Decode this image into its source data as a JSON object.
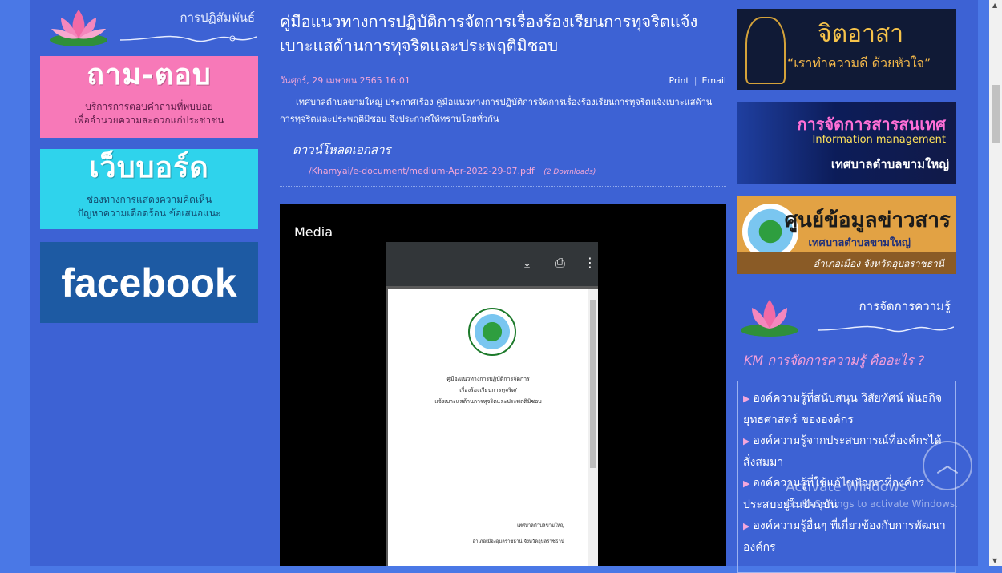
{
  "left": {
    "section_title": "การปฏิสัมพันธ์",
    "qa": {
      "big": "ถาม-ตอบ",
      "line1": "บริการการตอบคำถามที่พบบ่อย",
      "line2": "เพื่ออำนวยความสะดวกแก่ประชาชน"
    },
    "webboard": {
      "big": "เว็บบอร์ด",
      "line1": "ช่องทางการแสดงความคิดเห็น",
      "line2": "ปัญหาความเดือดร้อน ข้อเสนอแนะ"
    },
    "facebook": "facebook"
  },
  "article": {
    "title": "คู่มือแนวทางการปฏิบัติการจัดการเรื่องร้องเรียนการทุจริตแจ้งเบาะแสด้านการทุจริตและประพฤติมิชอบ",
    "date": "วันศุกร์, 29 เมษายน 2565 16:01",
    "print": "Print",
    "email": "Email",
    "body": "เทศบาลตำบลขามใหญ่ ประกาศเรื่อง คู่มือแนวทางการปฏิบัติการจัดการเรื่องร้องเรียนการทุจริตแจ้งเบาะแสด้านการทุจริตและประพฤติมิชอบ จึงประกาศให้ทราบโดยทั่วกัน",
    "download_heading": "ดาวน์โหลดเอกสาร",
    "file_link": "/Khamyai/e-document/medium-Apr-2022-29-07.pdf",
    "downloads": "(2 Downloads)"
  },
  "media": {
    "label": "Media",
    "doc_title_1": "คู่มือ/แนวทางการปฏิบัติการจัดการ",
    "doc_title_2": "เรื่องร้องเรียนการทุจริต/",
    "doc_title_3": "แจ้งเบาะแสด้านการทุจริตและประพฤติมิชอบ",
    "doc_foot_1": "เทศบาลตำบลขามใหญ่",
    "doc_foot_2": "อำเภอเมืองอุบลราชธานี จังหวัดอุบลราชธานี"
  },
  "right": {
    "b1_title": "จิตอาสา",
    "b1_sub": "“เราทำความดี ด้วยหัวใจ”",
    "b2_title": "การจัดการสารสนเทศ",
    "b2_sub": "Information management",
    "b2_org": "เทศบาลตำบลขามใหญ่",
    "b3_title": "ศูนย์ข้อมูลข่าวสาร",
    "b3_org": "เทศบาลตำบลขามใหญ่",
    "b3_loc": "อำเภอเมือง จังหวัดอุบลราชธานี",
    "km_title": "การจัดการความรู้",
    "km_question": "KM การจัดการความรู้ คืออะไร ?",
    "km_items": [
      "องค์ความรู้ที่สนับสนุน วิสัยทัศน์ พันธกิจ ยุทธศาสตร์ ขององค์กร",
      "องค์ความรู้จากประสบการณ์ที่องค์กรได้สั่งสมมา",
      "องค์ความรู้ที่ใช้แก้ไขปัญหาที่องค์กรประสบอยู่ในปัจจุบัน",
      "องค์ความรู้อื่นๆ ที่เกี่ยวข้องกับการพัฒนาองค์กร"
    ]
  },
  "overlay": {
    "activate": "Activate Windows",
    "activate_sub": "Go to Settings to activate Windows."
  },
  "icons": [
    "download-icon",
    "print-icon",
    "more-vert-icon",
    "scroll-up-icon",
    "lotus-icon",
    "bullet-icon"
  ],
  "colors": {
    "page_bg": "#3d62d4",
    "accent_pink": "#f3a7d8",
    "qa_card": "#f779b8",
    "webboard_card": "#2fd3ec",
    "facebook": "#1d5aa3"
  }
}
